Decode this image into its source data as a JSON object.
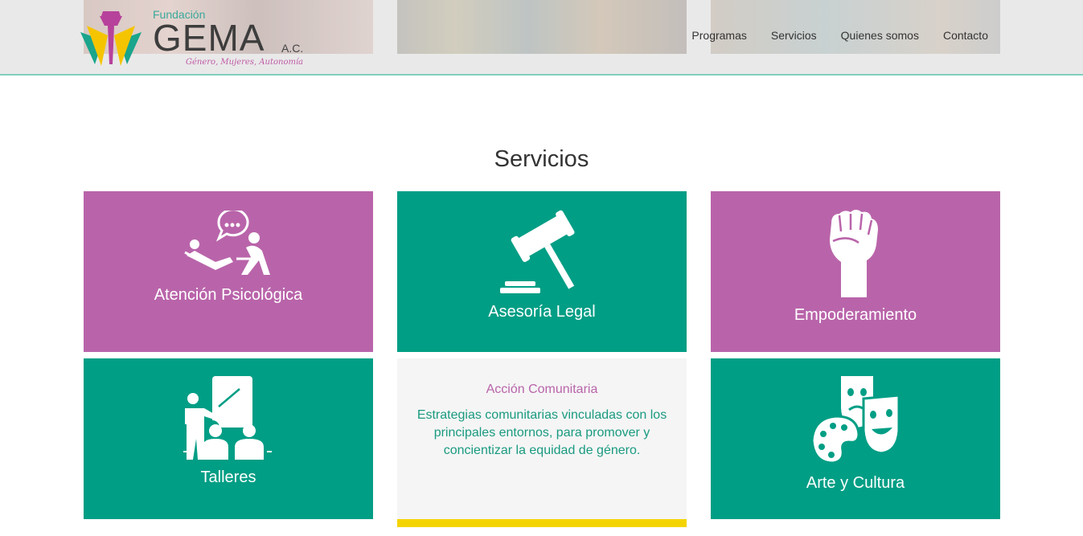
{
  "header": {
    "logo": {
      "fundacion": "Fundación",
      "name": "GEMA",
      "suffix": "A.C.",
      "tagline": "Género, Mujeres, Autonomía"
    },
    "nav": [
      "Programas",
      "Servicios",
      "Quienes somos",
      "Contacto"
    ]
  },
  "services": {
    "title": "Servicios",
    "tiles": [
      {
        "label": "Atención Psicológica",
        "icon": "therapy-icon",
        "color": "#b964aa"
      },
      {
        "label": "Asesoría Legal",
        "icon": "gavel-icon",
        "color": "#009e85"
      },
      {
        "label": "Empoderamiento",
        "icon": "raised-fist-icon",
        "color": "#b964aa"
      },
      {
        "label": "Talleres",
        "icon": "workshop-icon",
        "color": "#009e85"
      },
      {
        "label": "Acción Comunitaria",
        "description": "Estrategias comunitarias vinculadas con los principales entornos, para promover y concientizar la equidad de género.",
        "accent": "#f4d400"
      },
      {
        "label": "Arte y Cultura",
        "icon": "theater-masks-icon",
        "color": "#009e85"
      }
    ]
  },
  "colors": {
    "purple": "#b964aa",
    "green": "#009e85",
    "yellow": "#f4d400"
  }
}
